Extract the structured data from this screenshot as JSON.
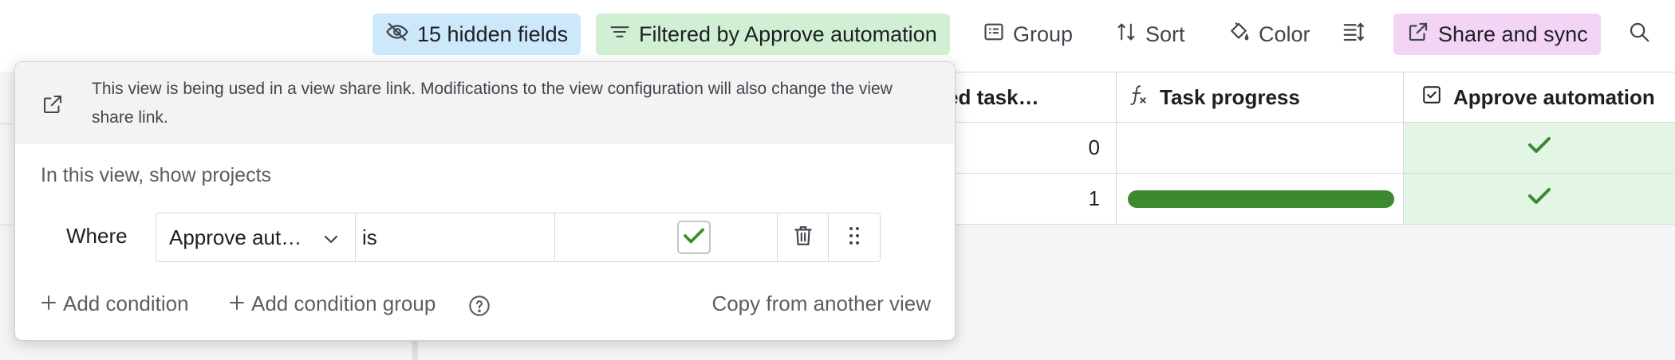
{
  "toolbar": {
    "hidden_fields": "15 hidden fields",
    "filter": "Filtered by Approve automation",
    "group": "Group",
    "sort": "Sort",
    "color": "Color",
    "share": "Share and sync"
  },
  "grid": {
    "columns": [
      "ed task…",
      "Task progress",
      "Approve automation"
    ],
    "rows": [
      {
        "count": "0",
        "progress": 0,
        "approved": true
      },
      {
        "count": "1",
        "progress": 1,
        "approved": true
      }
    ]
  },
  "filter_popover": {
    "notice": "This view is being used in a view share link. Modifications to the view configuration will also change the view share link.",
    "section_label": "In this view, show projects",
    "condition": {
      "where_label": "Where",
      "field": "Approve aut…",
      "operator": "is",
      "value_checked": true
    },
    "add_condition": "Add condition",
    "add_condition_group": "Add condition group",
    "copy_from_view": "Copy from another view"
  },
  "colors": {
    "hidden_fields_bg": "#cde7fb",
    "filter_bg": "#d1f0d3",
    "share_bg": "#f4d4f4",
    "check_green": "#3b8a2e",
    "approved_cell_bg": "#e3f5e4"
  },
  "icons": [
    "eye-off-icon",
    "filter-lines-icon",
    "group-list-icon",
    "sort-arrows-icon",
    "paint-bucket-icon",
    "row-height-icon",
    "share-external-icon",
    "search-icon",
    "formula-icon",
    "checkbox-field-icon",
    "checkmark-icon",
    "chevron-down-icon",
    "trash-icon",
    "drag-handle-icon",
    "plus-icon",
    "help-circle-icon"
  ]
}
